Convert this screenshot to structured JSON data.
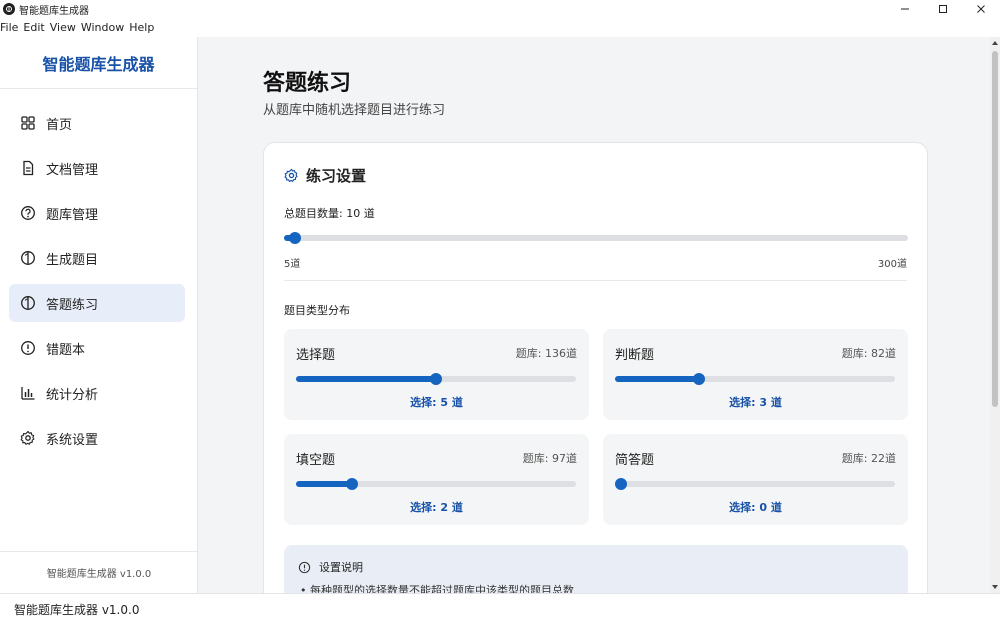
{
  "window": {
    "title": "智能题库生成器"
  },
  "menu": [
    "File",
    "Edit",
    "View",
    "Window",
    "Help"
  ],
  "sidebar": {
    "brand": "智能题库生成器",
    "items": [
      {
        "label": "首页",
        "icon": "grid-icon",
        "active": false
      },
      {
        "label": "文档管理",
        "icon": "document-icon",
        "active": false
      },
      {
        "label": "题库管理",
        "icon": "help-circle-icon",
        "active": false
      },
      {
        "label": "生成题目",
        "icon": "lightbulb-icon",
        "active": false
      },
      {
        "label": "答题练习",
        "icon": "lightbulb-icon",
        "active": true
      },
      {
        "label": "错题本",
        "icon": "alert-circle-icon",
        "active": false
      },
      {
        "label": "统计分析",
        "icon": "bar-chart-icon",
        "active": false
      },
      {
        "label": "系统设置",
        "icon": "gear-icon",
        "active": false
      }
    ],
    "footer": "智能题库生成器 v1.0.0"
  },
  "main": {
    "title": "答题练习",
    "subtitle": "从题库中随机选择题目进行练习",
    "settings": {
      "header": "练习设置",
      "total_label": "总题目数量: 10 道",
      "total_value": 10,
      "total_min": 5,
      "total_max": 300,
      "min_label": "5道",
      "max_label": "300道",
      "distribution_label": "题目类型分布",
      "types": [
        {
          "name": "选择题",
          "bank": "题库: 136道",
          "selected_label": "选择: 5 道",
          "value": 5,
          "max": 10
        },
        {
          "name": "判断题",
          "bank": "题库: 82道",
          "selected_label": "选择: 3 道",
          "value": 3,
          "max": 10
        },
        {
          "name": "填空题",
          "bank": "题库: 97道",
          "selected_label": "选择: 2 道",
          "value": 2,
          "max": 10
        },
        {
          "name": "简答题",
          "bank": "题库: 22道",
          "selected_label": "选择: 0 道",
          "value": 0,
          "max": 10
        }
      ]
    },
    "note": {
      "title": "设置说明",
      "items": [
        "• 每种题型的选择数量不能超过题库中该类型的题目总数"
      ]
    }
  },
  "statusbar": {
    "text": "智能题库生成器 v1.0.0"
  },
  "colors": {
    "accent": "#1565c0",
    "brand": "#1852a8",
    "active_bg": "#e8eef9"
  }
}
